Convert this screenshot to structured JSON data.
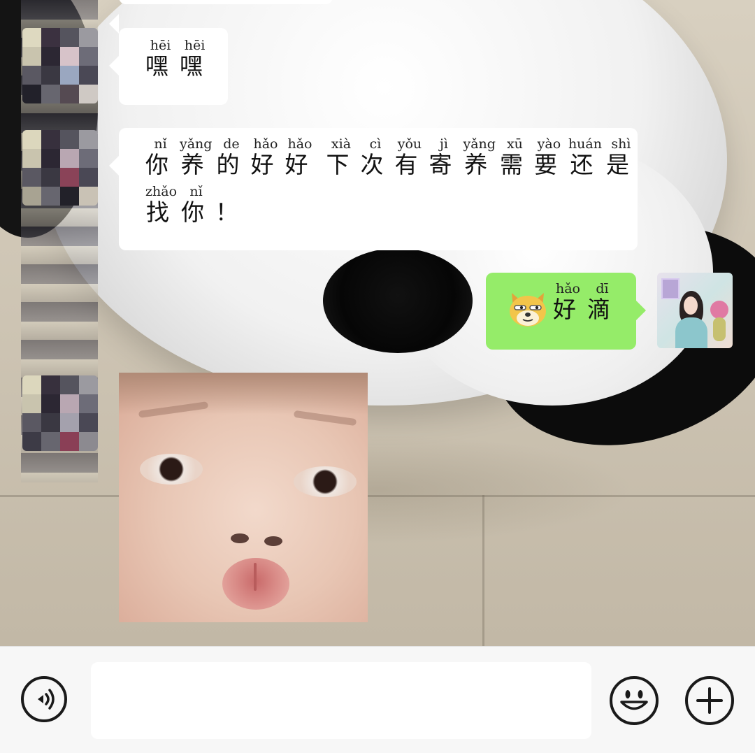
{
  "chat": {
    "messages": [
      {
        "sender": "other",
        "tokens": [
          {
            "char": "嘿",
            "pinyin": "hēi"
          },
          {
            "char": "嘿",
            "pinyin": "hēi"
          }
        ]
      },
      {
        "sender": "other",
        "line1": [
          {
            "char": "你",
            "pinyin": "nǐ"
          },
          {
            "char": "养",
            "pinyin": "yǎng"
          },
          {
            "char": "的",
            "pinyin": "de"
          },
          {
            "char": "好",
            "pinyin": "hǎo"
          },
          {
            "char": "好",
            "pinyin": "hǎo"
          },
          {
            "char": "下",
            "pinyin": "xià"
          },
          {
            "char": "次",
            "pinyin": "cì"
          },
          {
            "char": "有",
            "pinyin": "yǒu"
          },
          {
            "char": "寄",
            "pinyin": "jì"
          },
          {
            "char": "养",
            "pinyin": "yǎng"
          },
          {
            "char": "需",
            "pinyin": "xū"
          },
          {
            "char": "要",
            "pinyin": "yào"
          },
          {
            "char": "还",
            "pinyin": "huán"
          },
          {
            "char": "是",
            "pinyin": "shì"
          }
        ],
        "line2": [
          {
            "char": "找",
            "pinyin": "zhǎo"
          },
          {
            "char": "你",
            "pinyin": "nǐ"
          },
          {
            "char": "！",
            "pinyin": ""
          }
        ]
      },
      {
        "sender": "me",
        "emoji": "doge-emoji",
        "tokens": [
          {
            "char": "好",
            "pinyin": "hǎo"
          },
          {
            "char": "滴",
            "pinyin": "dī"
          }
        ]
      },
      {
        "sender": "other",
        "type": "image",
        "image": "baby-face-photo"
      }
    ]
  },
  "input_bar": {
    "voice_icon": "voice-icon",
    "emoji_icon": "smiley-icon",
    "more_icon": "plus-icon",
    "text_value": ""
  },
  "colors": {
    "my_bubble": "#95ec69",
    "other_bubble": "#ffffff",
    "input_bar_bg": "#f7f7f7"
  }
}
